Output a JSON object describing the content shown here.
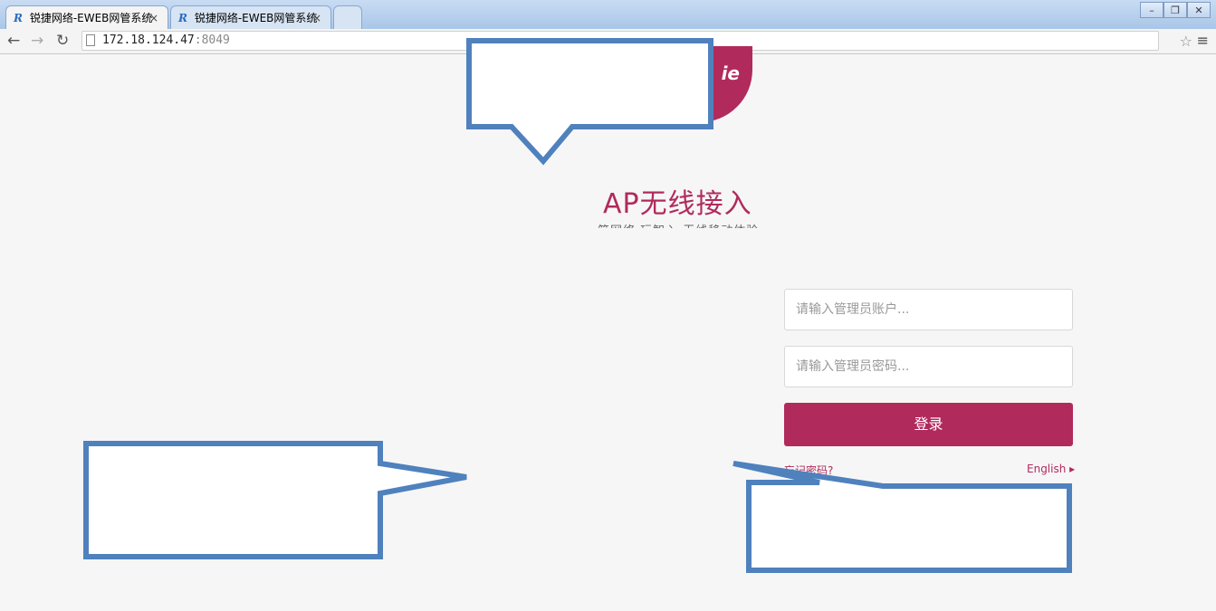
{
  "browser": {
    "tabs": [
      {
        "label": "锐捷网络-EWEB网管系统",
        "icon": "R"
      },
      {
        "label": "锐捷网络-EWEB网管系统",
        "icon": "R"
      }
    ],
    "url_host": "172.18.124.47",
    "url_port": ":8049",
    "close_glyph": "×"
  },
  "page": {
    "logo_text": "ie",
    "title": "AP无线接入",
    "subtitle": "简网络 玩智入 无线移动体验",
    "username_placeholder": "请输入管理员账户...",
    "password_placeholder": "请输入管理员密码...",
    "login_label": "登录",
    "forgot_label": "忘记密码?",
    "english_label": "English ▸"
  },
  "colors": {
    "brand": "#b12a5c",
    "callout_stroke": "#4f81bd"
  }
}
